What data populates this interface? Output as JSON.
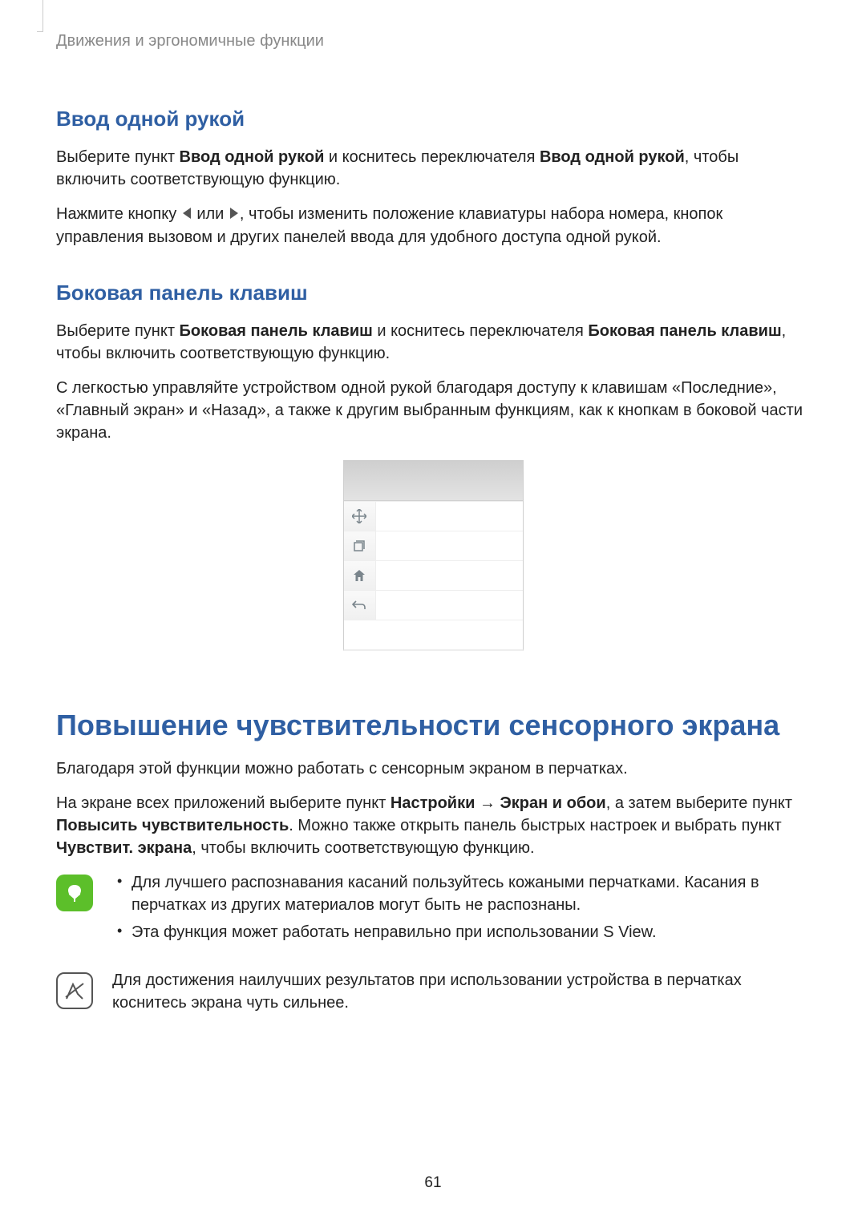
{
  "pageHeader": "Движения и эргономичные функции",
  "section1": {
    "heading": "Ввод одной рукой",
    "p1_parts": {
      "a": "Выберите пункт ",
      "bold1": "Ввод одной рукой",
      "b": " и коснитесь переключателя ",
      "bold2": "Ввод одной рукой",
      "c": ", чтобы включить соответствующую функцию."
    },
    "p2_parts": {
      "a": "Нажмите кнопку ",
      "b": " или ",
      "c": ", чтобы изменить положение клавиатуры набора номера, кнопок управления вызовом и других панелей ввода для удобного доступа одной рукой."
    }
  },
  "section2": {
    "heading": "Боковая панель клавиш",
    "p1_parts": {
      "a": "Выберите пункт ",
      "bold1": "Боковая панель клавиш",
      "b": " и коснитесь переключателя ",
      "bold2": "Боковая панель клавиш",
      "c": ", чтобы включить соответствующую функцию."
    },
    "p2": "С легкостью управляйте устройством одной рукой благодаря доступу к клавишам «Последние», «Главный экран» и «Назад», а также к другим выбранным функциям, как к кнопкам в боковой части экрана."
  },
  "section3": {
    "heading": "Повышение чувствительности сенсорного экрана",
    "p1": "Благодаря этой функции можно работать с сенсорным экраном в перчатках.",
    "p2_parts": {
      "a": "На экране всех приложений выберите пункт ",
      "bold1": "Настройки",
      "arrow": " → ",
      "bold2": "Экран и обои",
      "b": ", а затем выберите пункт ",
      "bold3": "Повысить чувствительность",
      "c": ". Можно также открыть панель быстрых настроек и выбрать пункт ",
      "bold4": "Чувствит. экрана",
      "d": ", чтобы включить соответствующую функцию."
    },
    "tips": [
      "Для лучшего распознавания касаний пользуйтесь кожаными перчатками. Касания в перчатках из других материалов могут быть не распознаны.",
      "Эта функция может работать неправильно при использовании S View."
    ],
    "note": "Для достижения наилучших результатов при использовании устройства в перчатках коснитесь экрана чуть сильнее."
  },
  "pageNumber": "61"
}
